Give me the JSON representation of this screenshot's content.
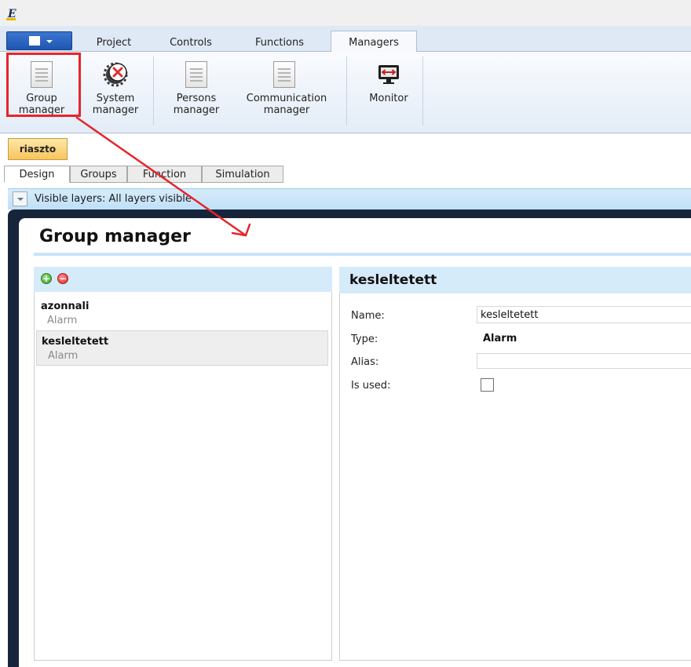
{
  "ribbon": {
    "tabs": {
      "project": "Project",
      "controls": "Controls",
      "functions": "Functions",
      "managers": "Managers"
    },
    "buttons": {
      "group_manager": [
        "Group",
        "manager"
      ],
      "system_manager": [
        "System",
        "manager"
      ],
      "persons_manager": [
        "Persons",
        "manager"
      ],
      "communication_manager": [
        "Communication",
        "manager"
      ],
      "monitor": [
        "Monitor"
      ]
    }
  },
  "document_tab": "riaszto",
  "view_tabs": {
    "design": "Design",
    "groups": "Groups",
    "function": "Function",
    "simulation": "Simulation"
  },
  "layers_text": "Visible layers: All layers visible",
  "group_manager": {
    "title": "Group manager",
    "groups": [
      {
        "name": "azonnali",
        "type": "Alarm"
      },
      {
        "name": "kesleltetett",
        "type": "Alarm"
      }
    ],
    "details": {
      "title": "kesleltetett",
      "name_label": "Name:",
      "name_value": "kesleltetett",
      "type_label": "Type:",
      "type_value": "Alarm",
      "alias_label": "Alias:",
      "alias_value": "",
      "is_used_label": "Is used:",
      "is_used": false
    }
  },
  "colors": {
    "highlight": "#e8242b",
    "document_tab": "#f8c55d",
    "header_blue": "#d6ebfa",
    "frame": "#17253a"
  },
  "icons": [
    "app-logo",
    "document-icon",
    "system-error-icon",
    "monitor-icon",
    "add-icon",
    "remove-icon"
  ]
}
